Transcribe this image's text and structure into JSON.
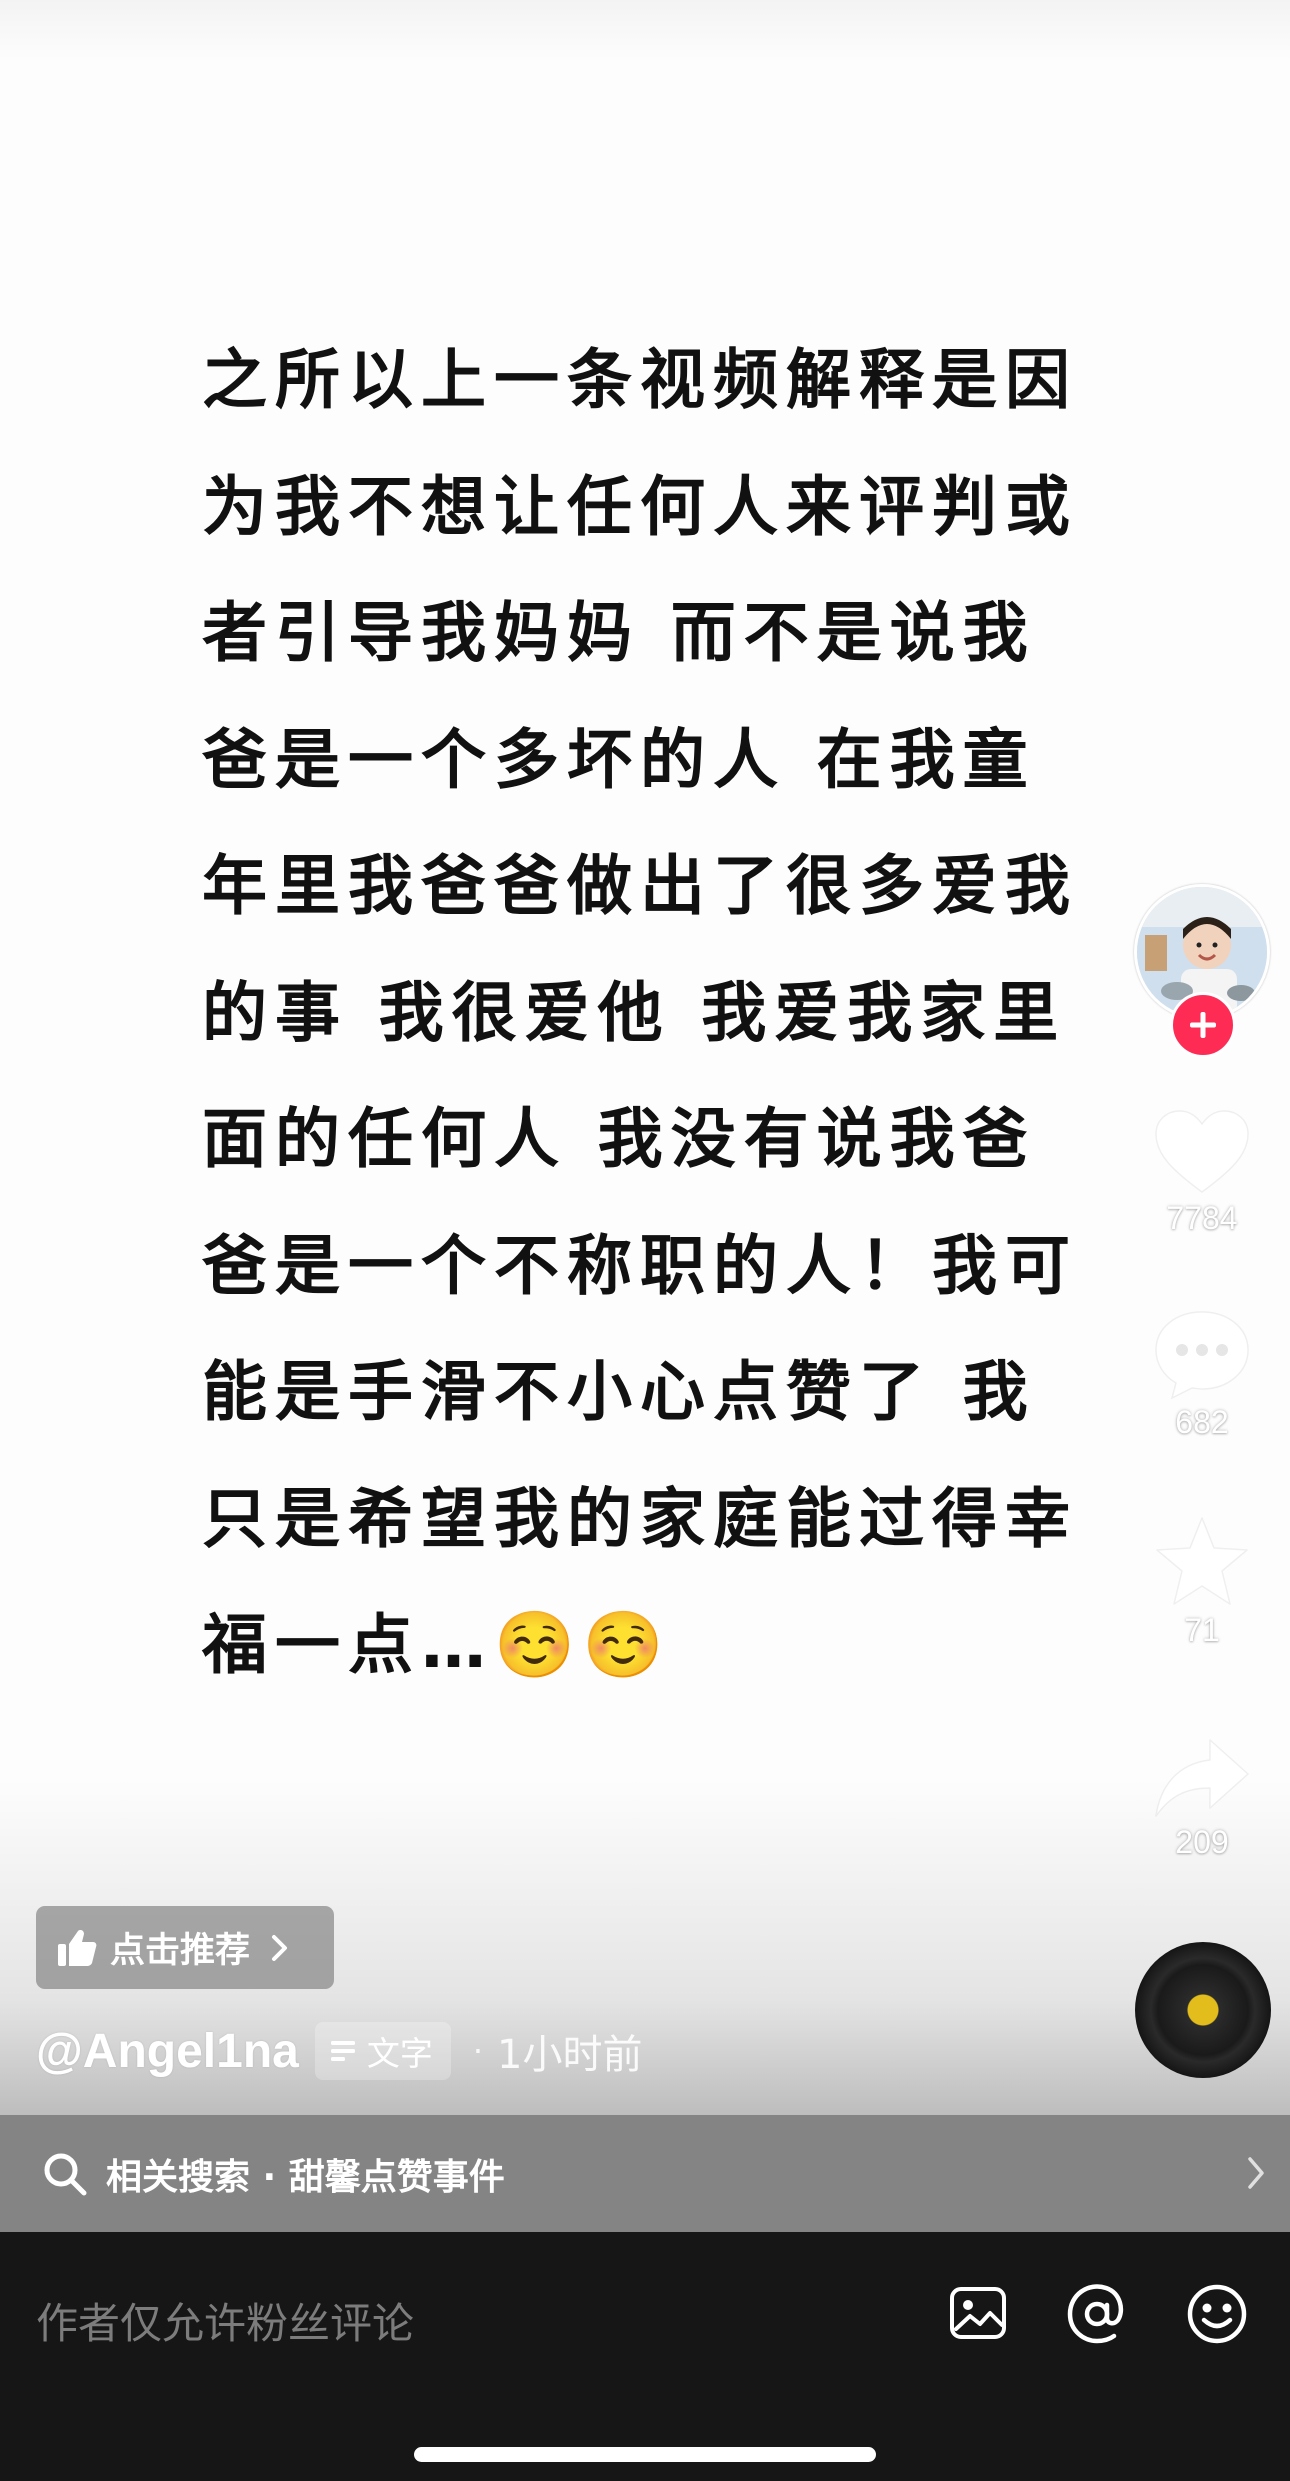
{
  "post": {
    "text": "之所以上一条视频解释是因为我不想让任何人来评判或者引导我妈妈 而不是说我爸是一个多坏的人 在我童年里我爸爸做出了很多爱我的事 我很爱他 我爱我家里面的任何人 我没有说我爸爸是一个不称职的人！我可能是手滑不小心点赞了 我只是希望我的家庭能过得幸福一点…☺️☺️"
  },
  "rail": {
    "likes": "7784",
    "comments": "682",
    "favorites": "71",
    "shares": "209",
    "icons": {
      "avatar": "creator-avatar",
      "follow": "plus-icon",
      "like": "heart-icon",
      "comment": "comment-bubble-icon",
      "favorite": "star-icon",
      "share": "share-arrow-icon",
      "music": "music-disc-icon"
    }
  },
  "recommend": {
    "label": "点击推荐",
    "icon": "thumbs-up-icon"
  },
  "author": {
    "handle": "@Angel1na",
    "tag_label": "文字",
    "separator": "·",
    "time_ago": "1小时前"
  },
  "related_search": {
    "text": "相关搜索 · 甜馨点赞事件"
  },
  "comment": {
    "placeholder": "作者仅允许粉丝评论",
    "icons": [
      "image-icon",
      "at-icon",
      "emoji-icon"
    ]
  },
  "colors": {
    "accent": "#fe2c55",
    "text_dark": "#111111",
    "bar_gray": "#848484",
    "comment_bg": "#161616"
  }
}
